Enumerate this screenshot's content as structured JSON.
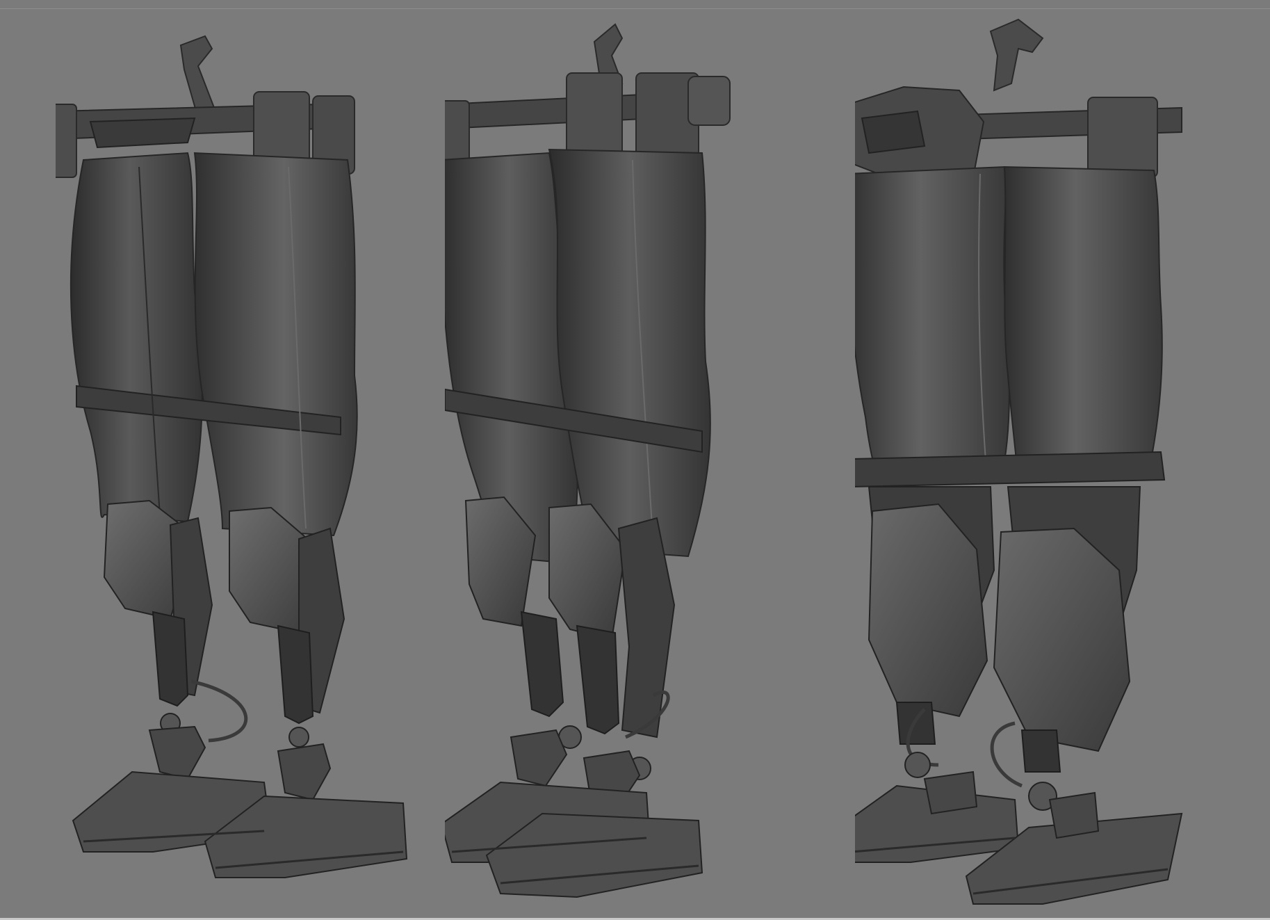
{
  "scene": {
    "background": "#7b7b7b",
    "material_base": "#4a4a4a",
    "material_light": "#6a6a6a",
    "material_dark": "#2e2e2e",
    "views": [
      {
        "id": "left",
        "angle": "front-three-quarter"
      },
      {
        "id": "middle",
        "angle": "side-three-quarter"
      },
      {
        "id": "right",
        "angle": "back-three-quarter"
      }
    ]
  }
}
